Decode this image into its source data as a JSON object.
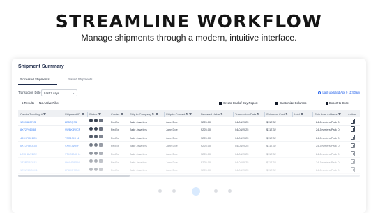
{
  "hero": {
    "title": "STREAMLINE WORKFLOW",
    "subtitle": "Manage shipments through a modern, intuitive interface."
  },
  "card": {
    "title": "Shipment Summary",
    "tabs": [
      {
        "label": "Processed Shipments",
        "active": true
      },
      {
        "label": "Saved Shipments",
        "active": false
      }
    ],
    "transaction_label": "Transaction Date",
    "transaction_value": "Last 7 days",
    "last_updated": "Last updated Apr 9 11:50am",
    "results_count": "5 Results",
    "no_active_filter": "No Active Filter",
    "actions": {
      "end_of_day": "Create End of Day Report",
      "customize": "Customize Columns",
      "export": "Export to Excel"
    }
  },
  "table": {
    "columns": [
      "Carrier Tracking #",
      "Shipment ID",
      "Status",
      "Carrier",
      "Ship to Company",
      "Ship to Contact",
      "Declared Value",
      "Transaction Date",
      "Shipment Cost",
      "Void",
      "Ship from Address",
      "Action"
    ],
    "rows": [
      {
        "tracking": "1Z4932079S",
        "shipment_id": "2B5TQS3",
        "carrier": "FedEx",
        "company": "Jade Jewelers",
        "contact": "John Doe",
        "declared": "$225.00",
        "date": "04/04/2025",
        "cost": "$117.32",
        "address": "24 Jewelers Park Dr"
      },
      {
        "tracking": "8X72F01038",
        "shipment_id": "9WBK3WCP",
        "carrier": "FedEx",
        "company": "Jade Jewelers",
        "contact": "John Doe",
        "declared": "$225.00",
        "date": "04/04/2025",
        "cost": "$117.32",
        "address": "24 Jewelers Park Dr"
      },
      {
        "tracking": "439HR021C3",
        "shipment_id": "T3G1NKH4",
        "carrier": "FedEx",
        "company": "Jade Jewelers",
        "contact": "John Doe",
        "declared": "$225.00",
        "date": "04/04/2025",
        "cost": "$117.32",
        "address": "24 Jewelers Park Dr"
      },
      {
        "tracking": "6XT2R3CK50",
        "shipment_id": "9X9T3WBF",
        "carrier": "FedEx",
        "company": "Jade Jewelers",
        "contact": "John Doe",
        "declared": "$225.00",
        "date": "04/04/2025",
        "cost": "$117.32",
        "address": "24 Jewelers Park Dr"
      },
      {
        "tracking": "L2XH8V21C2",
        "shipment_id": "7T4G1NKH4",
        "carrier": "FedEx",
        "company": "Jade Jewelers",
        "contact": "John Doe",
        "declared": "$225.00",
        "date": "04/04/2025",
        "cost": "$117.32",
        "address": "24 Jewelers Park Dr"
      },
      {
        "tracking": "1Z3RD1K012",
        "shipment_id": "8K4HT9RW",
        "carrier": "FedEx",
        "company": "Jade Jewelers",
        "contact": "John Doe",
        "declared": "$225.00",
        "date": "04/04/2025",
        "cost": "$117.32",
        "address": "24 Jewelers Park Dr"
      },
      {
        "tracking": "1Z9W48C0H1",
        "shipment_id": "2P8KD7CM",
        "carrier": "FedEx",
        "company": "Jade Jewelers",
        "contact": "John Doe",
        "declared": "$225.00",
        "date": "04/04/2025",
        "cost": "$117.32",
        "address": "24 Jewelers Park Dr"
      }
    ]
  },
  "icons": {
    "clock": "clock-icon",
    "report": "report-icon",
    "columns": "columns-icon",
    "export": "download-icon",
    "filter": "filter-icon",
    "sort": "sort-icon",
    "action": "action-icon"
  },
  "colors": {
    "accent": "#2563eb",
    "link": "#3b82f6",
    "title": "#1e2b4a",
    "header_bg": "#eef0f3"
  }
}
